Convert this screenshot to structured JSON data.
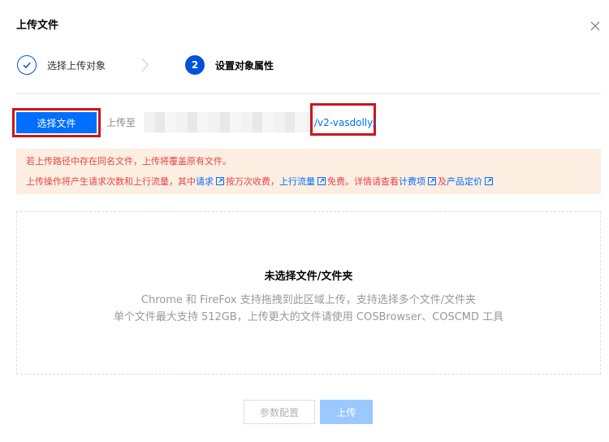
{
  "dialog": {
    "title": "上传文件",
    "close_icon": "close-icon"
  },
  "steps": [
    {
      "label": "选择上传对象",
      "state": "done",
      "icon": "check-icon"
    },
    {
      "label": "设置对象属性",
      "state": "active",
      "number": "2"
    }
  ],
  "upload": {
    "select_button": "选择文件",
    "upload_to_label": "上传至",
    "path_value": "/v2-vasdolly/"
  },
  "notice": {
    "line1": "若上传路径中存在同名文件，上传将覆盖原有文件。",
    "line2_a": "上传操作将产生请求次数和上行流量，其中",
    "link_request": "请求",
    "line2_b": "按万次收费，",
    "link_upstream": "上行流量",
    "line2_c": "免费。详情请查看",
    "link_billing": "计费项",
    "line2_d": "及",
    "link_pricing": "产品定价"
  },
  "dropzone": {
    "title": "未选择文件/文件夹",
    "hint1": "Chrome 和 FireFox 支持拖拽到此区域上传，支持选择多个文件/文件夹",
    "hint2": "单个文件最大支持 512GB，上传更大的文件请使用 COSBrowser、COSCMD 工具"
  },
  "footer": {
    "params_button": "参数配置",
    "upload_button": "上传"
  },
  "colors": {
    "primary": "#006eff",
    "step_blue": "#0052d9",
    "highlight_red": "#c8161d",
    "notice_bg": "#fdeee2",
    "notice_text": "#e54545"
  }
}
